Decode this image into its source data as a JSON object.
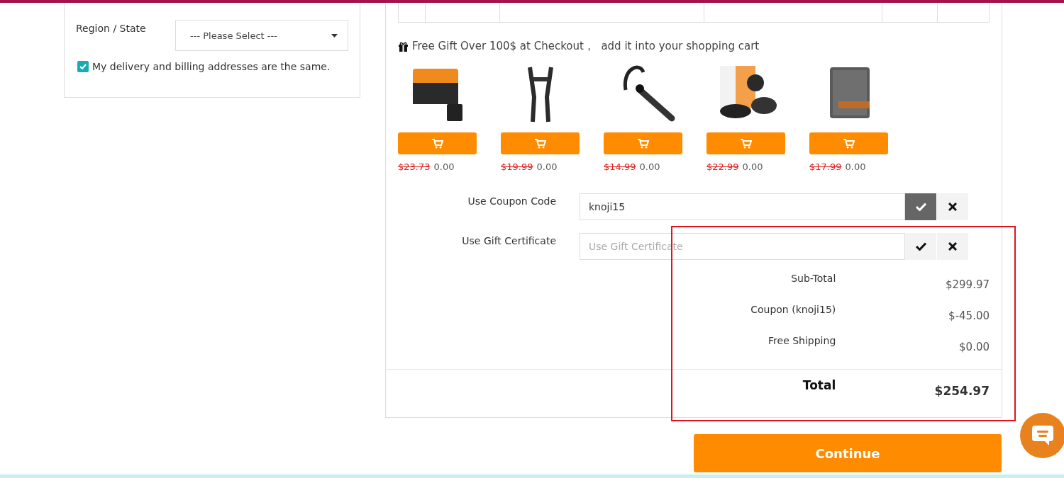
{
  "address_form": {
    "region": {
      "label": "Region / State",
      "placeholder": "--- Please Select ---"
    },
    "same_address": {
      "label": "My delivery and billing addresses are the same.",
      "checked": true
    }
  },
  "gift_offer": {
    "title": "Free Gift Over 100$ at Checkout，  add it into your shopping cart",
    "items": [
      {
        "kind": "picture",
        "old_price": "$23.73",
        "price": "0.00"
      },
      {
        "kind": "picture",
        "old_price": "$19.99",
        "price": "0.00"
      },
      {
        "kind": "picture",
        "old_price": "$14.99",
        "price": "0.00"
      },
      {
        "kind": "picture",
        "old_price": "$22.99",
        "price": "0.00"
      },
      {
        "kind": "picture",
        "old_price": "$17.99",
        "price": "0.00"
      }
    ]
  },
  "coupon": {
    "label": "Use Coupon Code",
    "value": "knoji15",
    "applied": true
  },
  "gift_certificate": {
    "label": "Use Gift Certificate",
    "placeholder": "Use Gift Certificate",
    "applied": false
  },
  "totals": [
    {
      "label": "Sub-Total",
      "value": "$299.97"
    },
    {
      "label": "Coupon (knoji15)",
      "value": "$-45.00"
    },
    {
      "label": "Free Shipping",
      "value": "$0.00"
    }
  ],
  "grand_total": {
    "label": "Total",
    "value": "$254.97"
  },
  "continue_button": "Continue"
}
